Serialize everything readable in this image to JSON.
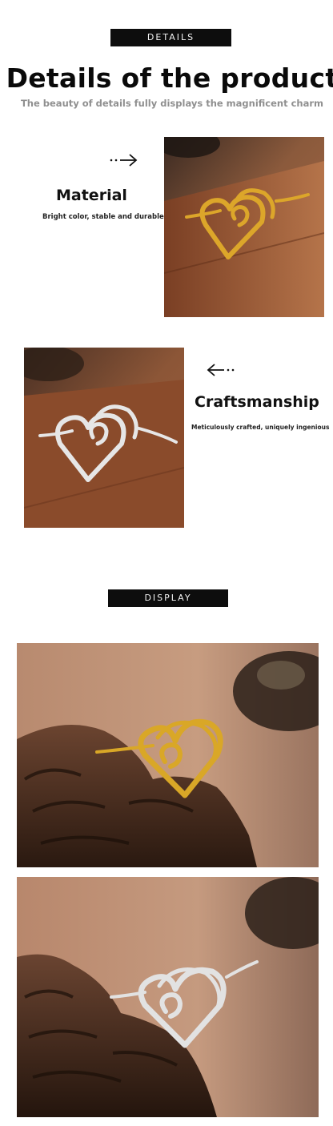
{
  "details_section": {
    "tag": "DETAILS",
    "title": "Details of the product",
    "subtitle": "The beauty of details fully displays the magnificent charm"
  },
  "features": {
    "material": {
      "title": "Material",
      "description": "Bright color, stable and durable",
      "arrow_icon": "dotted-arrow-right-icon"
    },
    "craftsmanship": {
      "title": "Craftsmanship",
      "description": "Meticulously crafted, uniquely ingenious",
      "arrow_icon": "dotted-arrow-left-icon"
    }
  },
  "display_section": {
    "tag": "DISPLAY"
  },
  "photos": [
    "gold heart ring on wooden table",
    "silver heart ring on wooden table",
    "gold heart ring on driftwood",
    "silver heart ring on driftwood"
  ],
  "colors": {
    "tag_background": "#0d0d0d",
    "gold": "#d9a727",
    "silver": "#d8d8d8",
    "wood": "#8a4b2a"
  }
}
